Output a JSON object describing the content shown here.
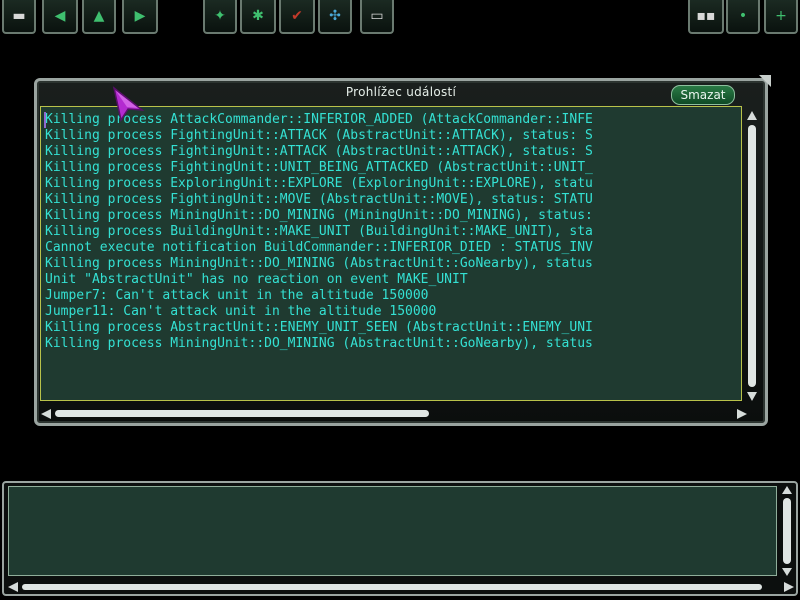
{
  "viewer": {
    "title": "Prohlížec událostí",
    "clear_label": "Smazat",
    "log_lines": [
      "Killing process AttackCommander::INFERIOR_ADDED (AttackCommander::INFE",
      "Killing process FightingUnit::ATTACK (AbstractUnit::ATTACK), status: S",
      "Killing process FightingUnit::ATTACK (AbstractUnit::ATTACK), status: S",
      "Killing process FightingUnit::UNIT_BEING_ATTACKED (AbstractUnit::UNIT_",
      "Killing process ExploringUnit::EXPLORE (ExploringUnit::EXPLORE), statu",
      "Killing process FightingUnit::MOVE (AbstractUnit::MOVE), status: STATU",
      "Killing process MiningUnit::DO_MINING (MiningUnit::DO_MINING), status:",
      "Killing process BuildingUnit::MAKE_UNIT (BuildingUnit::MAKE_UNIT), sta",
      "Cannot execute notification BuildCommander::INFERIOR_DIED : STATUS_INV",
      "Killing process MiningUnit::DO_MINING (AbstractUnit::GoNearby), status",
      "Unit \"AbstractUnit\" has no reaction on event MAKE_UNIT",
      "Jumper7: Can't attack unit in the altitude 150000",
      "Jumper11: Can't attack unit in the altitude 150000",
      "Killing process AbstractUnit::ENEMY_UNIT_SEEN (AbstractUnit::ENEMY_UNI",
      "Killing process MiningUnit::DO_MINING (AbstractUnit::GoNearby), status"
    ]
  },
  "colors": {
    "log_text": "#34e1d3",
    "log_background": "#1f3a30",
    "log_border": "#b9c24a",
    "clear_button": "#1f6a3a",
    "cursor": "#b32bd0"
  },
  "toolbar": {
    "left_buttons": [
      "menu-icon",
      "arrow-left-icon",
      "arrow-up-icon",
      "arrow-right-icon"
    ],
    "middle_buttons": [
      "unit-icon",
      "flag-icon",
      "attack-icon",
      "group-icon",
      "chat-icon"
    ],
    "right_buttons": [
      "map-icon",
      "dot-icon",
      "plus-icon"
    ]
  }
}
